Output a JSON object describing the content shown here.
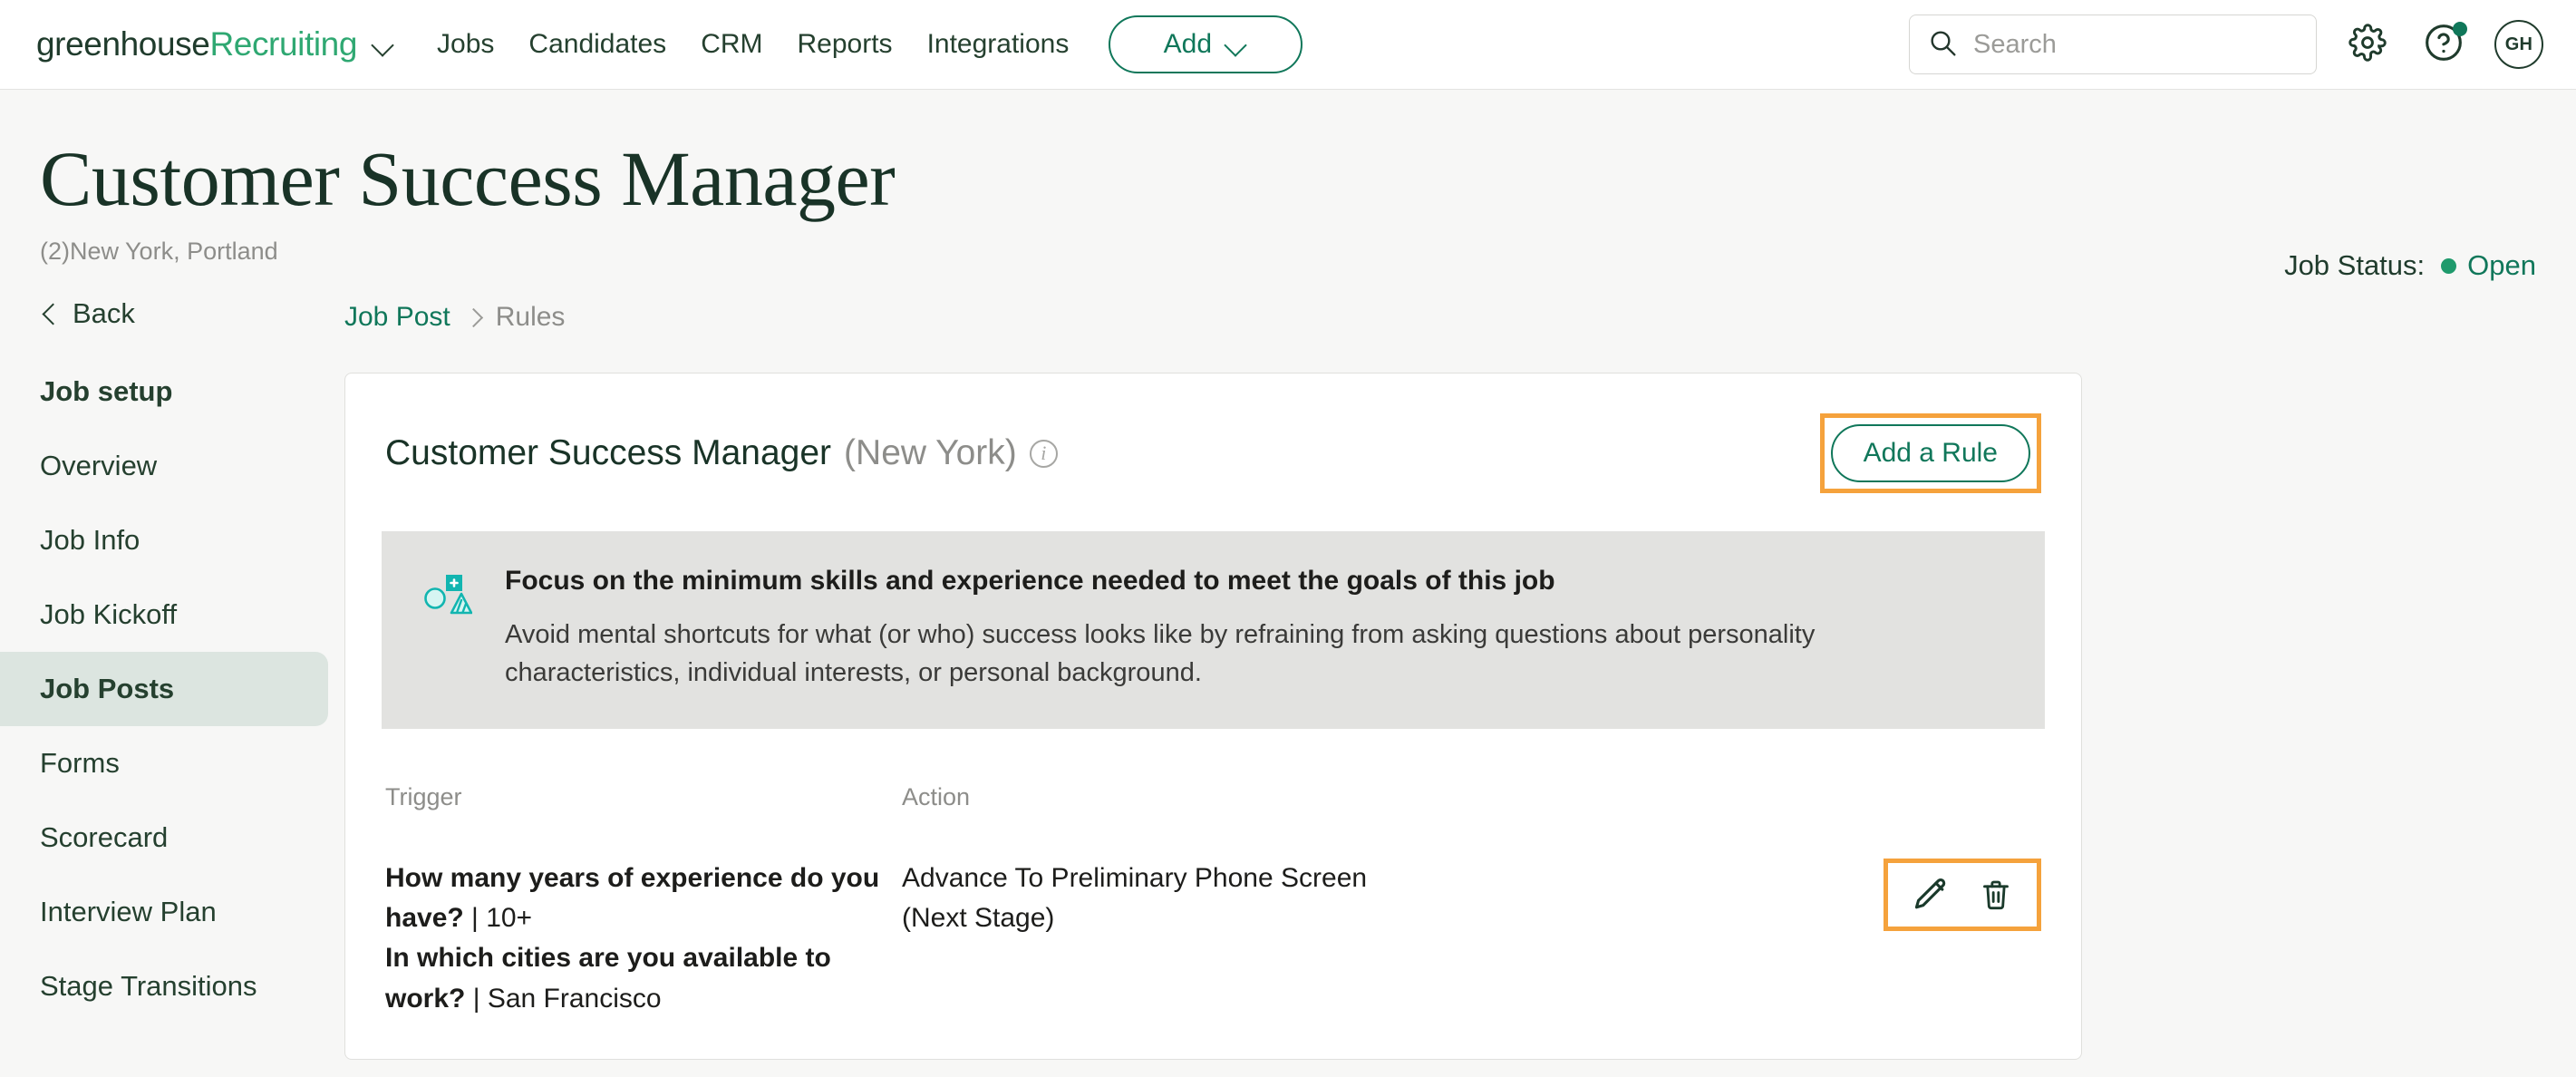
{
  "nav": {
    "brand_primary": "greenhouse",
    "brand_secondary": "Recruiting",
    "links": [
      "Jobs",
      "Candidates",
      "CRM",
      "Reports",
      "Integrations"
    ],
    "add_label": "Add",
    "search_placeholder": "Search",
    "search_value": "",
    "avatar_initials": "GH"
  },
  "page": {
    "title": "Customer Success Manager",
    "subtitle": "(2)New York, Portland",
    "status_label": "Job Status:",
    "status_value": "Open"
  },
  "sidebar": {
    "back_label": "Back",
    "items": [
      {
        "label": "Job setup",
        "bold": true,
        "active": false
      },
      {
        "label": "Overview",
        "bold": false,
        "active": false
      },
      {
        "label": "Job Info",
        "bold": false,
        "active": false
      },
      {
        "label": "Job Kickoff",
        "bold": false,
        "active": false
      },
      {
        "label": "Job Posts",
        "bold": true,
        "active": true
      },
      {
        "label": "Forms",
        "bold": false,
        "active": false
      },
      {
        "label": "Scorecard",
        "bold": false,
        "active": false
      },
      {
        "label": "Interview Plan",
        "bold": false,
        "active": false
      },
      {
        "label": "Stage Transitions",
        "bold": false,
        "active": false
      }
    ]
  },
  "breadcrumb": {
    "link": "Job Post",
    "current": "Rules"
  },
  "card": {
    "title": "Customer Success Manager",
    "location": "(New York)",
    "add_rule_label": "Add a Rule",
    "banner": {
      "title": "Focus on the minimum skills and experience needed to meet the goals of this job",
      "body": "Avoid mental shortcuts for what (or who) success looks like by refraining from asking questions about personality characteristics, individual interests, or personal background."
    },
    "table": {
      "headers": {
        "trigger": "Trigger",
        "action": "Action"
      },
      "rows": [
        {
          "trigger_lines": [
            {
              "question": "How many years of experience do you have?",
              "value": "10+"
            },
            {
              "question": "In which cities are you available to work?",
              "value": "San Francisco"
            }
          ],
          "action": "Advance To Preliminary Phone Screen (Next Stage)"
        }
      ]
    }
  },
  "colors": {
    "brand_green": "#10775A",
    "dark_green": "#193327",
    "accent_teal": "#12B5B0",
    "highlight_orange": "#F5A23C",
    "status_green": "#1F9A6C",
    "sidebar_active_bg": "#DCE5E0",
    "banner_bg": "#E2E2E0"
  }
}
